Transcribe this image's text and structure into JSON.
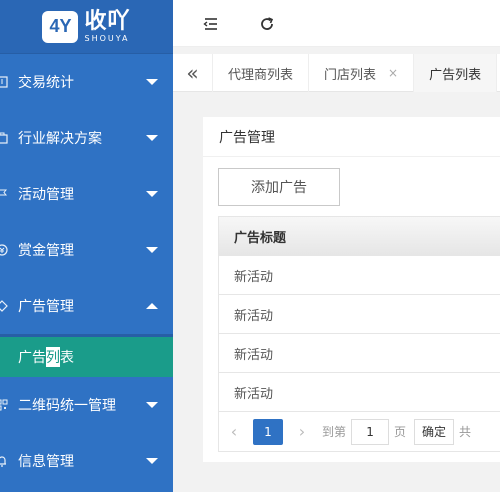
{
  "logo": {
    "mark": "4Y",
    "cn": "收吖",
    "en": "SHOUYA"
  },
  "sidebar": {
    "items": [
      {
        "label": "交易统计"
      },
      {
        "label": "行业解决方案"
      },
      {
        "label": "活动管理"
      },
      {
        "label": "赏金管理"
      },
      {
        "label": "广告管理"
      },
      {
        "label": "二维码统一管理"
      },
      {
        "label": "信息管理"
      }
    ],
    "active_sub": {
      "pre": "广告",
      "hl": "列",
      "post": "表"
    }
  },
  "tabs": [
    {
      "label": "代理商列表"
    },
    {
      "label": "门店列表",
      "close": "×"
    },
    {
      "label": "广告列表"
    }
  ],
  "card": {
    "title": "广告管理",
    "add_button": "添加广告",
    "column": "广告标题",
    "rows": [
      "新活动",
      "新活动",
      "新活动",
      "新活动"
    ]
  },
  "pager": {
    "current": "1",
    "goto_label": "到第",
    "page_value": "1",
    "page_unit": "页",
    "confirm": "确定",
    "total_prefix": "共"
  }
}
